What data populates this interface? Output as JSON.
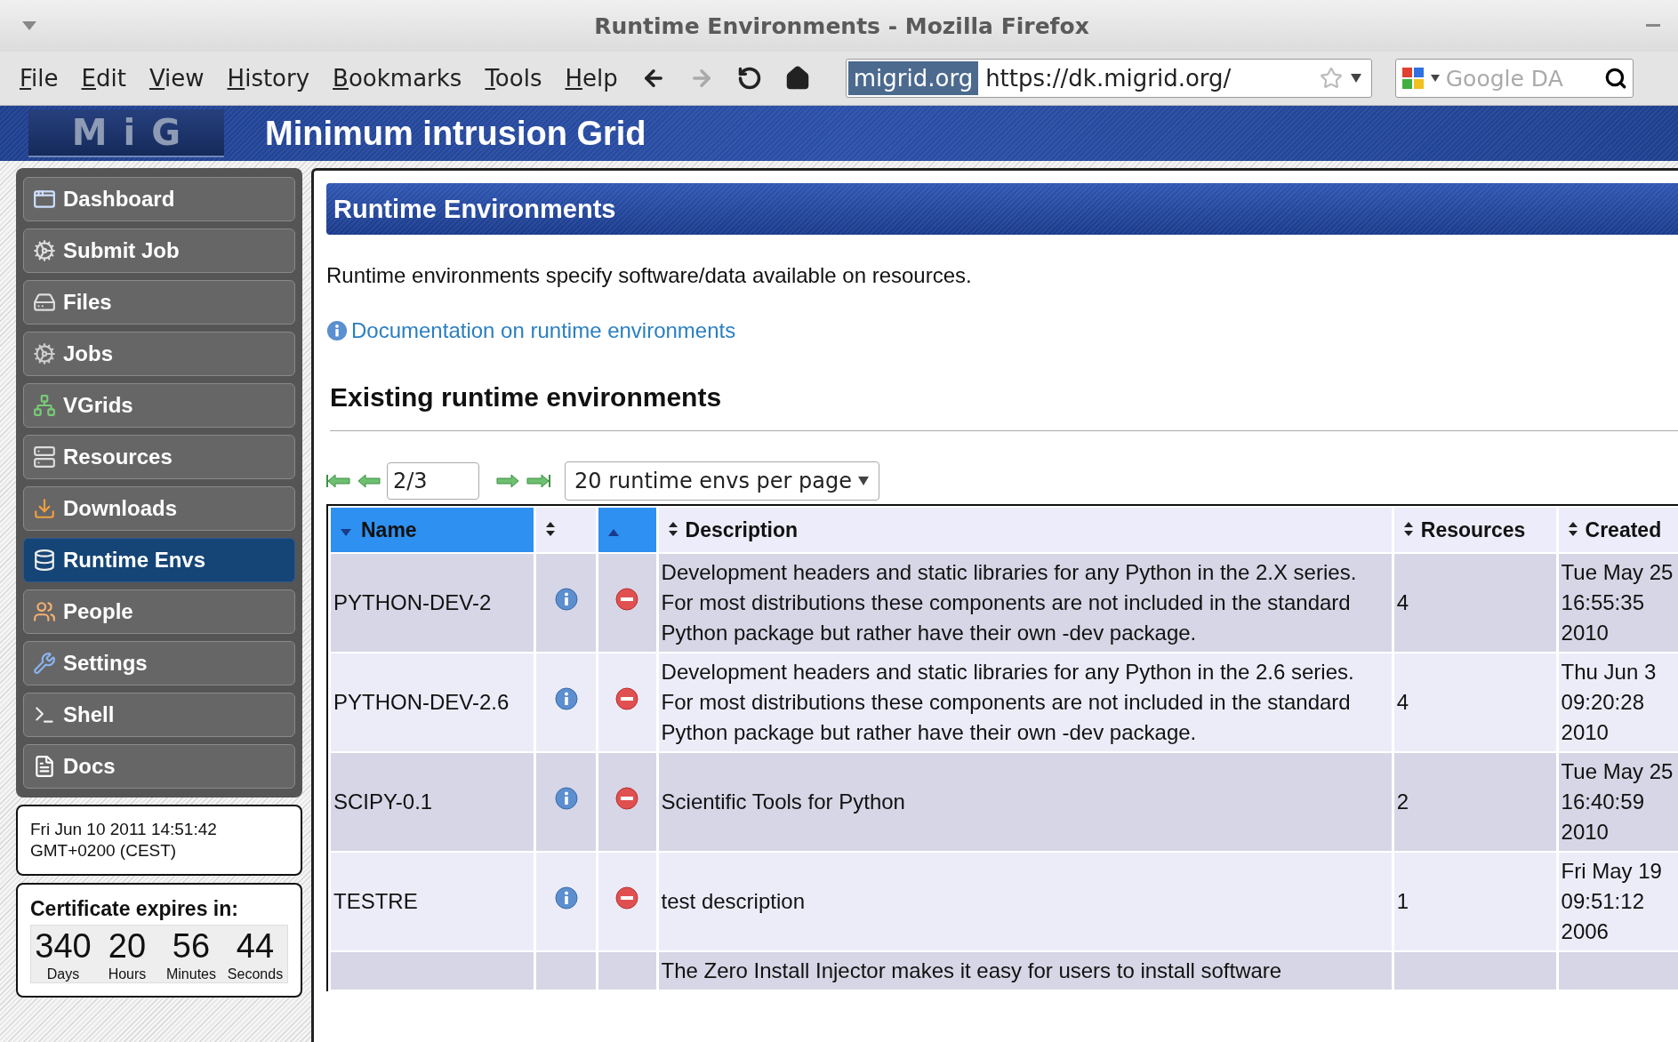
{
  "browser": {
    "title": "Runtime Environments - Mozilla Firefox",
    "menu": [
      "File",
      "Edit",
      "View",
      "History",
      "Bookmarks",
      "Tools",
      "Help"
    ],
    "forward_disabled": true,
    "site_badge": "migrid.org",
    "address": "https://dk.migrid.org/",
    "search_placeholder": "Google DA"
  },
  "site": {
    "logo": "MiG",
    "title": "Minimum intrusion Grid"
  },
  "sidebar": {
    "items": [
      {
        "label": "Dashboard",
        "selected": false
      },
      {
        "label": "Submit Job",
        "selected": false
      },
      {
        "label": "Files",
        "selected": false
      },
      {
        "label": "Jobs",
        "selected": false
      },
      {
        "label": "VGrids",
        "selected": false
      },
      {
        "label": "Resources",
        "selected": false
      },
      {
        "label": "Downloads",
        "selected": false
      },
      {
        "label": "Runtime Envs",
        "selected": true
      },
      {
        "label": "People",
        "selected": false
      },
      {
        "label": "Settings",
        "selected": false
      },
      {
        "label": "Shell",
        "selected": false
      },
      {
        "label": "Docs",
        "selected": false
      }
    ],
    "clock": [
      "Fri Jun 10 2011 14:51:42",
      "GMT+0200 (CEST)"
    ],
    "certificate": {
      "title": "Certificate expires in:",
      "units": [
        {
          "value": "340",
          "label": "Days"
        },
        {
          "value": "20",
          "label": "Hours"
        },
        {
          "value": "56",
          "label": "Minutes"
        },
        {
          "value": "44",
          "label": "Seconds"
        }
      ]
    }
  },
  "content": {
    "heading": "Runtime Environments",
    "intro": "Runtime environments specify software/data available on resources.",
    "doc_link": "Documentation on runtime environments",
    "section_heading": "Existing runtime environments",
    "pager": {
      "page": "2/3",
      "per_page": "20 runtime envs per page"
    },
    "table": {
      "columns": [
        {
          "label": "Name",
          "sorted_ascending": false,
          "sorted_descending": true
        },
        {
          "sorted_ascending": false,
          "sorted_descending": false
        },
        {
          "sorted_ascending": true,
          "sorted_descending": false
        },
        {
          "label": "Description",
          "sorted_ascending": false,
          "sorted_descending": false
        },
        {
          "label": "Resources",
          "sorted_ascending": false,
          "sorted_descending": false
        },
        {
          "label": "Created",
          "sorted_ascending": false,
          "sorted_descending": false
        }
      ],
      "rows": [
        {
          "name": "PYTHON-DEV-2",
          "description": [
            "Development headers and static libraries for any Python in the 2.X series.",
            "For most distributions these components are not included in the standard Python package but rather have their own -dev package."
          ],
          "resources": "4",
          "created": "Tue May 25 16:55:35 2010"
        },
        {
          "name": "PYTHON-DEV-2.6",
          "description": [
            "Development headers and static libraries for any Python in the 2.6 series.",
            "For most distributions these components are not included in the standard Python package but rather have their own -dev package."
          ],
          "resources": "4",
          "created": "Thu Jun 3 09:20:28 2010"
        },
        {
          "name": "SCIPY-0.1",
          "description": [
            "Scientific Tools for Python"
          ],
          "resources": "2",
          "created": "Tue May 25 16:40:59 2010"
        },
        {
          "name": "TESTRE",
          "description": [
            "test description"
          ],
          "resources": "1",
          "created": "Fri May 19 09:51:12 2006"
        },
        {
          "description": [
            "The Zero Install Injector makes it easy for users to install software"
          ]
        }
      ]
    }
  }
}
